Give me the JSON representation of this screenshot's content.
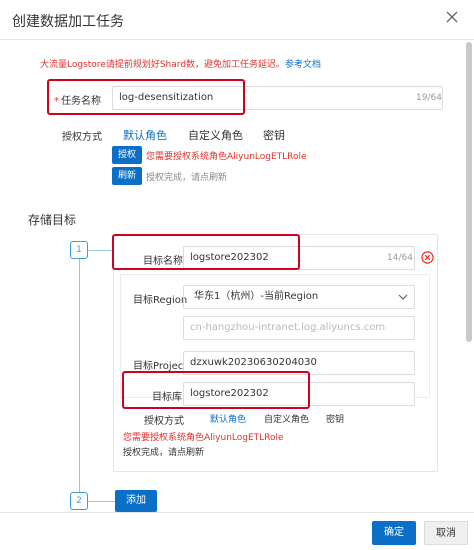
{
  "dialog": {
    "title": "创建数据加工任务"
  },
  "warning": {
    "text": "大流量Logstore请提前规划好Shard数，避免加工任务延迟。",
    "link": "参考文档"
  },
  "task": {
    "name_label": "任务名称",
    "name_value": "log-desensitization",
    "name_counter": "19/64"
  },
  "auth": {
    "label": "授权方式",
    "tabs": [
      "默认角色",
      "自定义角色",
      "密钥"
    ],
    "active_tab": "默认角色",
    "authorize_button": "授权",
    "authorize_note": "您需要授权系统角色AliyunLogETLRole",
    "refresh_button": "刷新",
    "refresh_note": "授权完成，请点刷新"
  },
  "storage": {
    "section_title": "存储目标",
    "steps": [
      "1",
      "2"
    ],
    "target_name_label": "目标名称",
    "target_name_value": "logstore202302",
    "target_name_counter": "14/64",
    "region_label": "目标Region",
    "region_value": "华东1（杭州）-当前Region",
    "endpoint_value": "cn-hangzhou-intranet.log.aliyuncs.com",
    "project_label": "目标Project",
    "project_value": "dzxuwk20230630204030",
    "logstore_label": "目标库",
    "logstore_value": "logstore202302",
    "auth_label": "授权方式",
    "auth_tabs": [
      "默认角色",
      "自定义角色",
      "密钥"
    ],
    "auth_active_tab": "默认角色",
    "auth_note": "您需要授权系统角色AliyunLogETLRole",
    "auth_done_note": "授权完成，请点刷新",
    "add_button": "添加"
  },
  "footer": {
    "ok_button": "确定",
    "cancel_button": "取消"
  },
  "colors": {
    "primary": "#0b6fc7",
    "danger": "#e3312c",
    "highlight_box": "#d0021b"
  }
}
